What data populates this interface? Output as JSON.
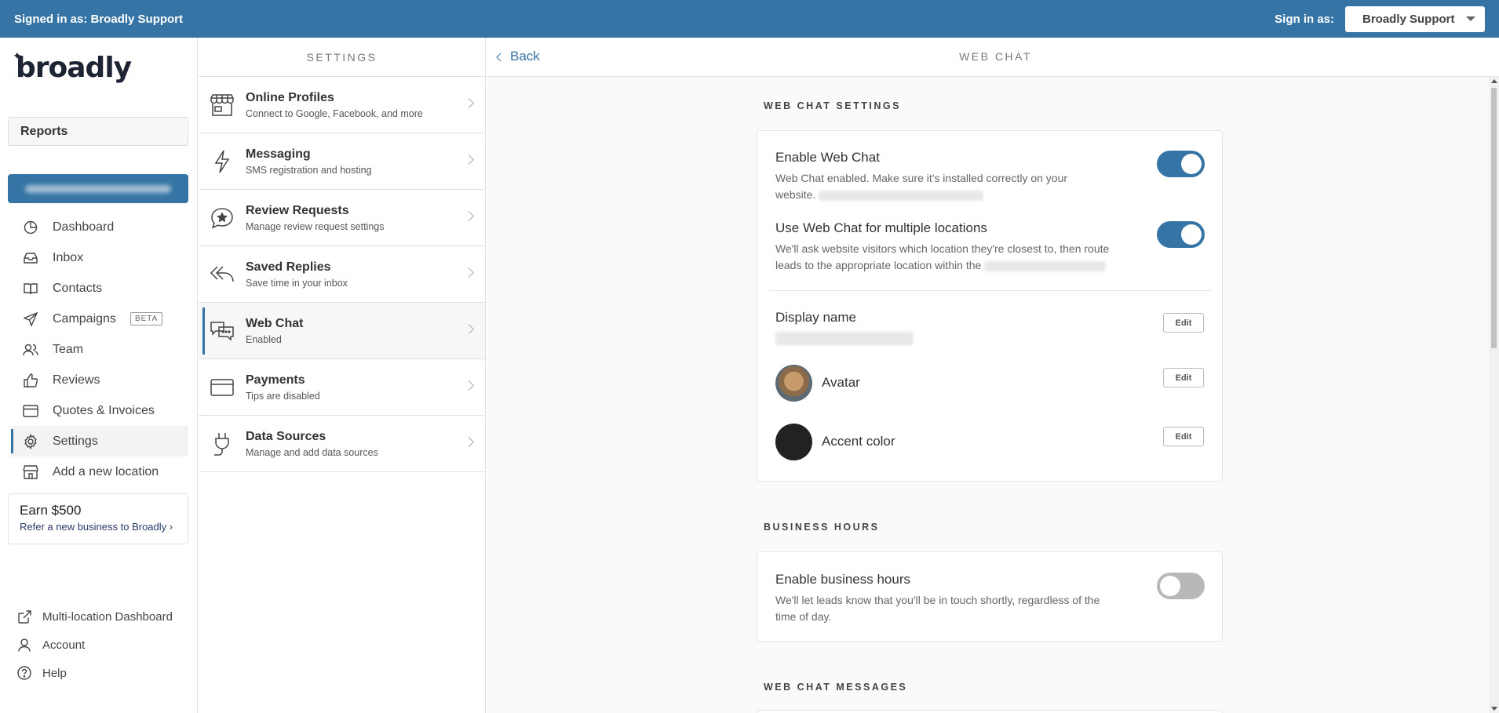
{
  "topbar": {
    "signed_in": "Signed in as: Broadly Support",
    "sign_in_as_label": "Sign in as:",
    "sign_in_as_value": "Broadly Support"
  },
  "sidebar": {
    "logo": "broadly",
    "reports": "Reports",
    "nav": [
      {
        "label": "Dashboard",
        "icon": "pie-chart-icon"
      },
      {
        "label": "Inbox",
        "icon": "inbox-icon"
      },
      {
        "label": "Contacts",
        "icon": "book-icon"
      },
      {
        "label": "Campaigns",
        "icon": "send-icon",
        "badge": "BETA"
      },
      {
        "label": "Team",
        "icon": "users-icon"
      },
      {
        "label": "Reviews",
        "icon": "thumbs-up-icon"
      },
      {
        "label": "Quotes & Invoices",
        "icon": "card-icon"
      },
      {
        "label": "Settings",
        "icon": "gear-icon",
        "active": true
      },
      {
        "label": "Add a new location",
        "icon": "store-icon"
      }
    ],
    "earn": {
      "title": "Earn $500",
      "subtitle": "Refer a new business to Broadly",
      "arrow": "›"
    },
    "bottom": [
      {
        "label": "Multi-location Dashboard",
        "icon": "external-link-icon"
      },
      {
        "label": "Account",
        "icon": "user-icon"
      },
      {
        "label": "Help",
        "icon": "help-icon"
      }
    ]
  },
  "settings": {
    "header": "SETTINGS",
    "items": [
      {
        "title": "Online Profiles",
        "sub": "Connect to Google, Facebook, and more",
        "icon": "storefront-icon"
      },
      {
        "title": "Messaging",
        "sub": "SMS registration and hosting",
        "icon": "lightning-icon"
      },
      {
        "title": "Review Requests",
        "sub": "Manage review request settings",
        "icon": "star-bubble-icon"
      },
      {
        "title": "Saved Replies",
        "sub": "Save time in your inbox",
        "icon": "reply-icon"
      },
      {
        "title": "Web Chat",
        "sub": "Enabled",
        "icon": "chat-bubbles-icon",
        "active": true
      },
      {
        "title": "Payments",
        "sub": "Tips are disabled",
        "icon": "credit-card-icon"
      },
      {
        "title": "Data Sources",
        "sub": "Manage and add data sources",
        "icon": "plug-icon"
      }
    ]
  },
  "main": {
    "back": "Back",
    "title": "WEB CHAT",
    "web_chat_settings_label": "WEB CHAT SETTINGS",
    "enable_web_chat": {
      "title": "Enable Web Chat",
      "desc_line1": "Web Chat enabled. Make sure it's installed correctly on your",
      "desc_line2": "website.",
      "enabled": true
    },
    "multi_location": {
      "title": "Use Web Chat for multiple locations",
      "desc_line1": "We'll ask website visitors which location they're closest to, then route",
      "desc_line2": "leads to the appropriate location within the",
      "enabled": true
    },
    "display_name": {
      "title": "Display name",
      "edit": "Edit"
    },
    "avatar": {
      "title": "Avatar",
      "edit": "Edit"
    },
    "accent_color": {
      "title": "Accent color",
      "edit": "Edit",
      "color": "#222222"
    },
    "business_hours_label": "BUSINESS HOURS",
    "business_hours": {
      "title": "Enable business hours",
      "desc_line1": "We'll let leads know that you'll be in touch shortly, regardless of the",
      "desc_line2": "time of day.",
      "enabled": false
    },
    "web_chat_messages_label": "WEB CHAT MESSAGES"
  },
  "colors": {
    "primary": "#3574a4"
  }
}
